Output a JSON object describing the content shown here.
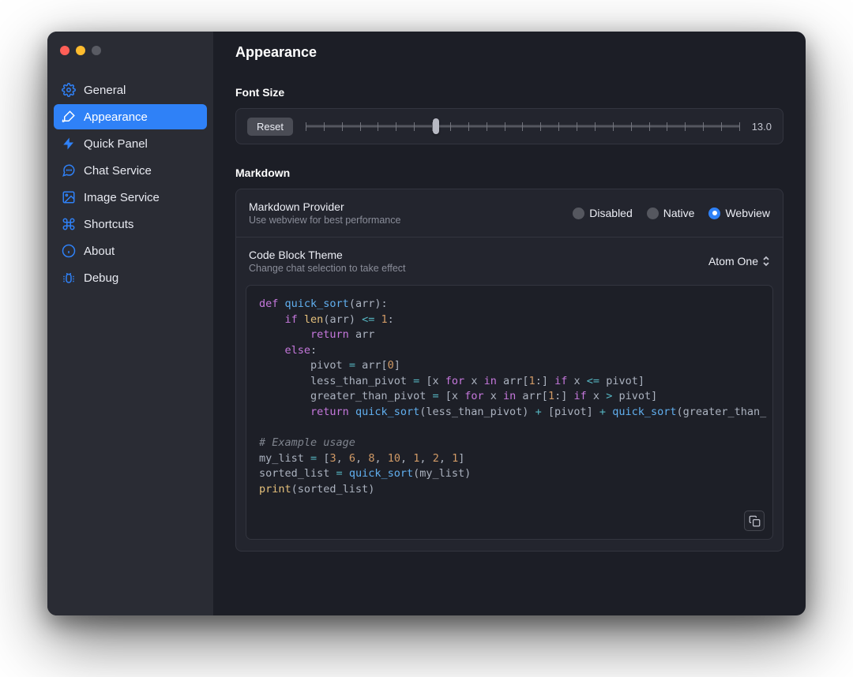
{
  "header": {
    "title": "Appearance"
  },
  "sidebar": {
    "items": [
      {
        "label": "General"
      },
      {
        "label": "Appearance"
      },
      {
        "label": "Quick Panel"
      },
      {
        "label": "Chat Service"
      },
      {
        "label": "Image Service"
      },
      {
        "label": "Shortcuts"
      },
      {
        "label": "About"
      },
      {
        "label": "Debug"
      }
    ],
    "active_index": 1
  },
  "fontsize": {
    "section_title": "Font Size",
    "reset_label": "Reset",
    "value": "13.0",
    "tick_count": 25,
    "thumb_percent": 30
  },
  "markdown": {
    "section_title": "Markdown",
    "provider": {
      "title": "Markdown Provider",
      "subtitle": "Use webview for best performance",
      "options": [
        {
          "label": "Disabled"
        },
        {
          "label": "Native"
        },
        {
          "label": "Webview"
        }
      ],
      "selected_index": 2
    },
    "theme": {
      "title": "Code Block Theme",
      "subtitle": "Change chat selection to take effect",
      "value": "Atom One"
    },
    "code_sample": {
      "lines_raw": [
        "def quick_sort(arr):",
        "    if len(arr) <= 1:",
        "        return arr",
        "    else:",
        "        pivot = arr[0]",
        "        less_than_pivot = [x for x in arr[1:] if x <= pivot]",
        "        greater_than_pivot = [x for x in arr[1:] if x > pivot]",
        "        return quick_sort(less_than_pivot) + [pivot] + quick_sort(greater_than_",
        "",
        "# Example usage",
        "my_list = [3, 6, 8, 10, 1, 2, 1]",
        "sorted_list = quick_sort(my_list)",
        "print(sorted_list)"
      ]
    }
  }
}
